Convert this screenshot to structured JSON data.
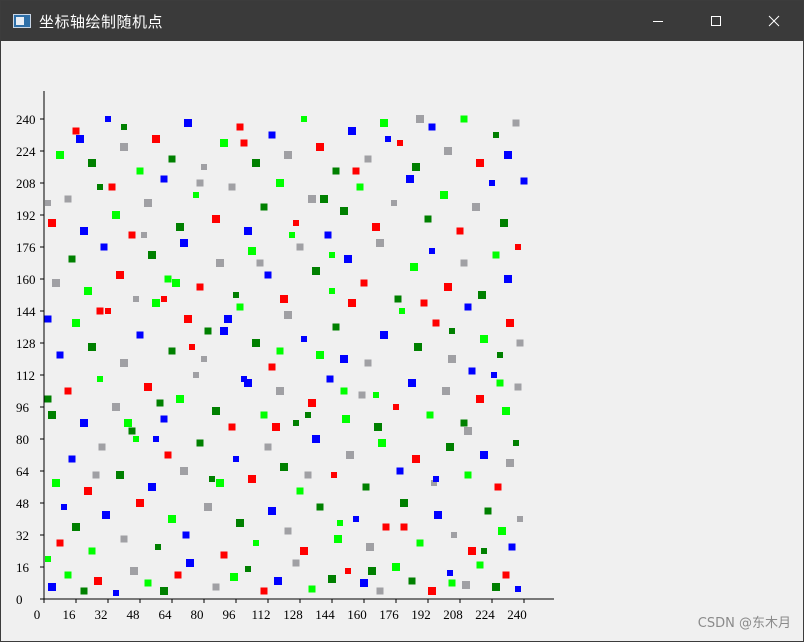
{
  "window": {
    "title": "坐标轴绘制随机点",
    "icons": {
      "app": "window-app-icon",
      "minimize": "minimize-icon",
      "maximize": "maximize-icon",
      "close": "close-icon"
    }
  },
  "watermark": "CSDN @东木月",
  "chart_data": {
    "type": "scatter",
    "xlim": [
      0,
      264
    ],
    "ylim": [
      0,
      256
    ],
    "x_ticks": [
      0,
      16,
      32,
      48,
      64,
      80,
      96,
      112,
      128,
      144,
      160,
      176,
      192,
      208,
      224,
      240
    ],
    "y_ticks": [
      0,
      16,
      32,
      48,
      64,
      80,
      96,
      112,
      128,
      144,
      160,
      176,
      192,
      208,
      224,
      240
    ],
    "grid": false,
    "colors": [
      "#ff0000",
      "#00ff00",
      "#0000ff",
      "#008000",
      "#a0a0a4"
    ],
    "points": [
      [
        4,
        6,
        2,
        6
      ],
      [
        12,
        12,
        1,
        5
      ],
      [
        20,
        4,
        3,
        5
      ],
      [
        27,
        9,
        0,
        6
      ],
      [
        36,
        3,
        2,
        4
      ],
      [
        45,
        14,
        4,
        6
      ],
      [
        52,
        8,
        1,
        5
      ],
      [
        60,
        4,
        3,
        6
      ],
      [
        67,
        12,
        0,
        5
      ],
      [
        73,
        18,
        2,
        6
      ],
      [
        86,
        6,
        4,
        5
      ],
      [
        95,
        11,
        1,
        6
      ],
      [
        102,
        15,
        3,
        4
      ],
      [
        110,
        4,
        0,
        5
      ],
      [
        117,
        9,
        2,
        6
      ],
      [
        126,
        18,
        4,
        5
      ],
      [
        134,
        5,
        1,
        5
      ],
      [
        144,
        10,
        3,
        6
      ],
      [
        152,
        14,
        0,
        4
      ],
      [
        160,
        8,
        2,
        6
      ],
      [
        168,
        4,
        4,
        5
      ],
      [
        176,
        16,
        1,
        6
      ],
      [
        184,
        9,
        3,
        5
      ],
      [
        194,
        4,
        0,
        6
      ],
      [
        203,
        13,
        2,
        4
      ],
      [
        211,
        7,
        4,
        6
      ],
      [
        218,
        17,
        1,
        5
      ],
      [
        226,
        6,
        3,
        6
      ],
      [
        231,
        12,
        0,
        5
      ],
      [
        237,
        5,
        2,
        4
      ],
      [
        8,
        28,
        0,
        5
      ],
      [
        16,
        36,
        3,
        6
      ],
      [
        24,
        24,
        1,
        5
      ],
      [
        31,
        42,
        2,
        6
      ],
      [
        40,
        30,
        4,
        5
      ],
      [
        48,
        48,
        0,
        6
      ],
      [
        57,
        26,
        3,
        4
      ],
      [
        64,
        40,
        1,
        6
      ],
      [
        71,
        32,
        2,
        5
      ],
      [
        82,
        46,
        4,
        6
      ],
      [
        90,
        22,
        0,
        5
      ],
      [
        98,
        38,
        3,
        6
      ],
      [
        106,
        28,
        1,
        4
      ],
      [
        114,
        44,
        2,
        6
      ],
      [
        122,
        34,
        4,
        5
      ],
      [
        130,
        24,
        0,
        6
      ],
      [
        138,
        46,
        3,
        5
      ],
      [
        147,
        30,
        1,
        6
      ],
      [
        156,
        40,
        2,
        4
      ],
      [
        163,
        26,
        4,
        6
      ],
      [
        171,
        36,
        0,
        5
      ],
      [
        180,
        48,
        3,
        6
      ],
      [
        188,
        28,
        1,
        5
      ],
      [
        197,
        42,
        2,
        6
      ],
      [
        205,
        32,
        4,
        4
      ],
      [
        214,
        24,
        0,
        6
      ],
      [
        222,
        44,
        3,
        5
      ],
      [
        229,
        34,
        1,
        6
      ],
      [
        234,
        26,
        2,
        5
      ],
      [
        238,
        40,
        4,
        4
      ],
      [
        6,
        58,
        1,
        6
      ],
      [
        14,
        70,
        2,
        5
      ],
      [
        22,
        54,
        0,
        6
      ],
      [
        29,
        76,
        4,
        5
      ],
      [
        38,
        62,
        3,
        6
      ],
      [
        46,
        80,
        1,
        4
      ],
      [
        54,
        56,
        2,
        6
      ],
      [
        62,
        72,
        0,
        5
      ],
      [
        70,
        64,
        4,
        6
      ],
      [
        78,
        78,
        3,
        5
      ],
      [
        88,
        58,
        1,
        6
      ],
      [
        96,
        70,
        2,
        4
      ],
      [
        104,
        60,
        0,
        6
      ],
      [
        112,
        76,
        4,
        5
      ],
      [
        120,
        66,
        3,
        6
      ],
      [
        128,
        54,
        1,
        5
      ],
      [
        136,
        80,
        2,
        6
      ],
      [
        145,
        62,
        0,
        4
      ],
      [
        153,
        72,
        4,
        6
      ],
      [
        161,
        56,
        3,
        5
      ],
      [
        169,
        78,
        1,
        6
      ],
      [
        178,
        64,
        2,
        5
      ],
      [
        186,
        70,
        0,
        6
      ],
      [
        195,
        58,
        4,
        4
      ],
      [
        203,
        76,
        3,
        6
      ],
      [
        212,
        62,
        1,
        5
      ],
      [
        220,
        72,
        2,
        6
      ],
      [
        227,
        56,
        0,
        5
      ],
      [
        233,
        68,
        4,
        6
      ],
      [
        236,
        78,
        3,
        4
      ],
      [
        4,
        92,
        3,
        6
      ],
      [
        12,
        104,
        0,
        5
      ],
      [
        20,
        88,
        2,
        6
      ],
      [
        28,
        110,
        1,
        4
      ],
      [
        36,
        96,
        4,
        6
      ],
      [
        44,
        84,
        3,
        5
      ],
      [
        52,
        106,
        0,
        6
      ],
      [
        60,
        90,
        2,
        5
      ],
      [
        68,
        100,
        1,
        6
      ],
      [
        76,
        112,
        4,
        4
      ],
      [
        86,
        94,
        3,
        6
      ],
      [
        94,
        86,
        0,
        5
      ],
      [
        102,
        108,
        2,
        6
      ],
      [
        110,
        92,
        1,
        5
      ],
      [
        118,
        104,
        4,
        6
      ],
      [
        126,
        88,
        3,
        4
      ],
      [
        134,
        98,
        0,
        6
      ],
      [
        143,
        110,
        2,
        5
      ],
      [
        151,
        90,
        1,
        6
      ],
      [
        159,
        102,
        4,
        5
      ],
      [
        167,
        86,
        3,
        6
      ],
      [
        176,
        96,
        0,
        4
      ],
      [
        184,
        108,
        2,
        6
      ],
      [
        193,
        92,
        1,
        5
      ],
      [
        201,
        104,
        4,
        6
      ],
      [
        210,
        88,
        3,
        5
      ],
      [
        218,
        100,
        0,
        6
      ],
      [
        225,
        112,
        2,
        4
      ],
      [
        231,
        94,
        1,
        6
      ],
      [
        237,
        106,
        4,
        5
      ],
      [
        8,
        122,
        2,
        5
      ],
      [
        16,
        138,
        1,
        6
      ],
      [
        24,
        126,
        3,
        6
      ],
      [
        32,
        144,
        0,
        4
      ],
      [
        40,
        118,
        4,
        6
      ],
      [
        48,
        132,
        2,
        5
      ],
      [
        56,
        148,
        1,
        6
      ],
      [
        64,
        124,
        3,
        5
      ],
      [
        72,
        140,
        0,
        6
      ],
      [
        80,
        120,
        4,
        4
      ],
      [
        90,
        134,
        2,
        6
      ],
      [
        98,
        146,
        1,
        5
      ],
      [
        106,
        128,
        3,
        6
      ],
      [
        114,
        116,
        0,
        5
      ],
      [
        122,
        142,
        4,
        6
      ],
      [
        130,
        130,
        2,
        4
      ],
      [
        138,
        122,
        1,
        6
      ],
      [
        146,
        136,
        3,
        5
      ],
      [
        154,
        148,
        0,
        6
      ],
      [
        162,
        118,
        4,
        5
      ],
      [
        170,
        132,
        2,
        6
      ],
      [
        179,
        144,
        1,
        4
      ],
      [
        187,
        126,
        3,
        6
      ],
      [
        196,
        138,
        0,
        5
      ],
      [
        204,
        120,
        4,
        6
      ],
      [
        212,
        146,
        2,
        5
      ],
      [
        220,
        130,
        1,
        6
      ],
      [
        228,
        122,
        3,
        4
      ],
      [
        233,
        138,
        0,
        6
      ],
      [
        238,
        128,
        4,
        5
      ],
      [
        6,
        158,
        4,
        6
      ],
      [
        14,
        170,
        3,
        5
      ],
      [
        22,
        154,
        1,
        6
      ],
      [
        30,
        176,
        2,
        5
      ],
      [
        38,
        162,
        0,
        6
      ],
      [
        46,
        150,
        4,
        4
      ],
      [
        54,
        172,
        3,
        6
      ],
      [
        62,
        160,
        1,
        5
      ],
      [
        70,
        178,
        2,
        6
      ],
      [
        78,
        156,
        0,
        5
      ],
      [
        88,
        168,
        4,
        6
      ],
      [
        96,
        152,
        3,
        4
      ],
      [
        104,
        174,
        1,
        6
      ],
      [
        112,
        162,
        2,
        5
      ],
      [
        120,
        150,
        0,
        6
      ],
      [
        128,
        176,
        4,
        5
      ],
      [
        136,
        164,
        3,
        6
      ],
      [
        144,
        154,
        1,
        4
      ],
      [
        152,
        170,
        2,
        6
      ],
      [
        160,
        158,
        0,
        5
      ],
      [
        168,
        178,
        4,
        6
      ],
      [
        177,
        150,
        3,
        5
      ],
      [
        185,
        166,
        1,
        6
      ],
      [
        194,
        174,
        2,
        4
      ],
      [
        202,
        156,
        0,
        6
      ],
      [
        210,
        168,
        4,
        5
      ],
      [
        219,
        152,
        3,
        6
      ],
      [
        226,
        172,
        1,
        5
      ],
      [
        232,
        160,
        2,
        6
      ],
      [
        237,
        176,
        0,
        4
      ],
      [
        4,
        188,
        0,
        6
      ],
      [
        12,
        200,
        4,
        5
      ],
      [
        20,
        184,
        2,
        6
      ],
      [
        28,
        206,
        3,
        4
      ],
      [
        36,
        192,
        1,
        6
      ],
      [
        44,
        182,
        0,
        5
      ],
      [
        52,
        198,
        4,
        6
      ],
      [
        60,
        210,
        2,
        5
      ],
      [
        68,
        186,
        3,
        6
      ],
      [
        76,
        202,
        1,
        4
      ],
      [
        86,
        190,
        0,
        6
      ],
      [
        94,
        206,
        4,
        5
      ],
      [
        102,
        184,
        2,
        6
      ],
      [
        110,
        196,
        3,
        5
      ],
      [
        118,
        208,
        1,
        6
      ],
      [
        126,
        188,
        0,
        4
      ],
      [
        134,
        200,
        4,
        6
      ],
      [
        142,
        182,
        2,
        5
      ],
      [
        150,
        194,
        3,
        6
      ],
      [
        158,
        206,
        1,
        5
      ],
      [
        166,
        186,
        0,
        6
      ],
      [
        175,
        198,
        4,
        4
      ],
      [
        183,
        210,
        2,
        6
      ],
      [
        192,
        190,
        3,
        5
      ],
      [
        200,
        202,
        1,
        6
      ],
      [
        208,
        184,
        0,
        5
      ],
      [
        216,
        196,
        4,
        6
      ],
      [
        224,
        208,
        2,
        4
      ],
      [
        230,
        188,
        3,
        6
      ],
      [
        240,
        209,
        2,
        5
      ],
      [
        8,
        222,
        1,
        6
      ],
      [
        16,
        234,
        0,
        5
      ],
      [
        24,
        218,
        3,
        6
      ],
      [
        32,
        240,
        2,
        4
      ],
      [
        40,
        226,
        4,
        6
      ],
      [
        48,
        214,
        1,
        5
      ],
      [
        56,
        230,
        0,
        6
      ],
      [
        64,
        220,
        3,
        5
      ],
      [
        72,
        238,
        2,
        6
      ],
      [
        80,
        216,
        4,
        4
      ],
      [
        90,
        228,
        1,
        6
      ],
      [
        98,
        236,
        0,
        5
      ],
      [
        106,
        218,
        3,
        6
      ],
      [
        114,
        232,
        2,
        5
      ],
      [
        122,
        222,
        4,
        6
      ],
      [
        130,
        240,
        1,
        4
      ],
      [
        138,
        226,
        0,
        6
      ],
      [
        146,
        214,
        3,
        5
      ],
      [
        154,
        234,
        2,
        6
      ],
      [
        162,
        220,
        4,
        5
      ],
      [
        170,
        238,
        1,
        6
      ],
      [
        178,
        228,
        0,
        4
      ],
      [
        186,
        216,
        3,
        6
      ],
      [
        194,
        236,
        2,
        5
      ],
      [
        202,
        224,
        4,
        6
      ],
      [
        210,
        240,
        1,
        5
      ],
      [
        218,
        218,
        0,
        6
      ],
      [
        226,
        232,
        3,
        4
      ],
      [
        232,
        222,
        2,
        6
      ],
      [
        236,
        238,
        4,
        5
      ],
      [
        10,
        46,
        2,
        4
      ],
      [
        26,
        62,
        4,
        5
      ],
      [
        42,
        88,
        1,
        6
      ],
      [
        58,
        98,
        3,
        5
      ],
      [
        74,
        126,
        0,
        4
      ],
      [
        92,
        140,
        2,
        6
      ],
      [
        108,
        168,
        4,
        5
      ],
      [
        124,
        182,
        1,
        4
      ],
      [
        140,
        200,
        3,
        6
      ],
      [
        156,
        214,
        0,
        5
      ],
      [
        172,
        230,
        2,
        4
      ],
      [
        188,
        240,
        4,
        6
      ],
      [
        204,
        8,
        1,
        5
      ],
      [
        220,
        24,
        3,
        4
      ],
      [
        18,
        230,
        2,
        6
      ],
      [
        34,
        206,
        0,
        5
      ],
      [
        50,
        182,
        4,
        4
      ],
      [
        66,
        158,
        1,
        6
      ],
      [
        82,
        134,
        3,
        5
      ],
      [
        100,
        110,
        2,
        4
      ],
      [
        116,
        86,
        0,
        6
      ],
      [
        132,
        62,
        4,
        5
      ],
      [
        148,
        38,
        1,
        4
      ],
      [
        164,
        14,
        3,
        6
      ],
      [
        180,
        36,
        0,
        5
      ],
      [
        196,
        60,
        2,
        4
      ],
      [
        212,
        84,
        4,
        6
      ],
      [
        228,
        108,
        1,
        5
      ],
      [
        84,
        60,
        3,
        4
      ],
      [
        150,
        120,
        2,
        6
      ],
      [
        150,
        104,
        1,
        5
      ],
      [
        60,
        150,
        0,
        4
      ],
      [
        2,
        140,
        2,
        5
      ],
      [
        2,
        20,
        1,
        4
      ],
      [
        2,
        100,
        3,
        5
      ],
      [
        2,
        198,
        4,
        4
      ],
      [
        118,
        124,
        1,
        5
      ],
      [
        56,
        80,
        2,
        4
      ],
      [
        190,
        148,
        0,
        5
      ],
      [
        40,
        236,
        3,
        4
      ],
      [
        100,
        228,
        0,
        5
      ],
      [
        166,
        102,
        1,
        4
      ],
      [
        214,
        114,
        2,
        5
      ],
      [
        132,
        92,
        3,
        4
      ],
      [
        78,
        208,
        4,
        5
      ],
      [
        144,
        172,
        1,
        4
      ],
      [
        28,
        144,
        0,
        5
      ],
      [
        204,
        134,
        3,
        4
      ]
    ]
  }
}
